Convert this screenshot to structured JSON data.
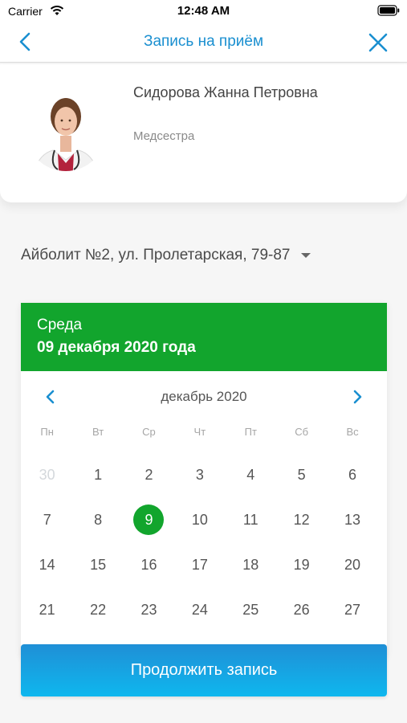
{
  "status_bar": {
    "carrier": "Carrier",
    "time": "12:48 AM"
  },
  "nav": {
    "title": "Запись на приём",
    "accent_color": "#1a8fd0"
  },
  "doctor": {
    "name": "Сидорова Жанна Петровна",
    "role": "Медсестра"
  },
  "clinic": {
    "selected": "Айболит №2, ул. Пролетарская, 79-87"
  },
  "calendar": {
    "header_color": "#12a52d",
    "weekday": "Среда",
    "selected_date": "09 декабря 2020 года",
    "month_label": "декабрь 2020",
    "weekdays": [
      "Пн",
      "Вт",
      "Ср",
      "Чт",
      "Пт",
      "Сб",
      "Вс"
    ],
    "days": [
      "30",
      "1",
      "2",
      "3",
      "4",
      "5",
      "6",
      "7",
      "8",
      "9",
      "10",
      "11",
      "12",
      "13",
      "14",
      "15",
      "16",
      "17",
      "18",
      "19",
      "20",
      "21",
      "22",
      "23",
      "24",
      "25",
      "26",
      "27"
    ],
    "muted_days": [
      "30"
    ],
    "selected_day": "9"
  },
  "actions": {
    "continue_label": "Продолжить запись"
  },
  "icons": {
    "back": "chevron-left-icon",
    "close": "close-icon",
    "dropdown": "caret-down-icon",
    "month_prev": "chevron-left-icon",
    "month_next": "chevron-right-icon"
  }
}
